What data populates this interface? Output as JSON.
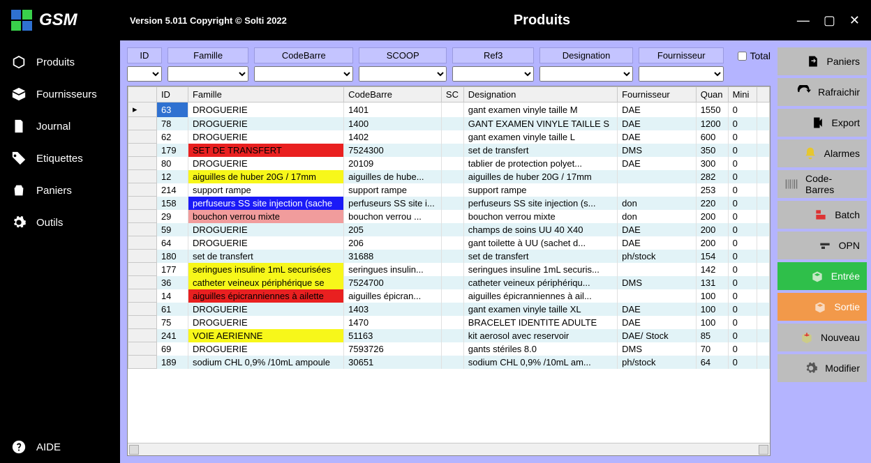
{
  "titlebar": {
    "app_name": "GSM",
    "version": "Version 5.011  Copyright © Solti 2022",
    "page": "Produits"
  },
  "sidebar": {
    "items": [
      {
        "label": "Produits"
      },
      {
        "label": "Fournisseurs"
      },
      {
        "label": "Journal"
      },
      {
        "label": "Etiquettes"
      },
      {
        "label": "Paniers"
      },
      {
        "label": "Outils"
      }
    ],
    "help": "AIDE"
  },
  "filters": {
    "id": "ID",
    "famille": "Famille",
    "codebarre": "CodeBarre",
    "scoop": "SCOOP",
    "ref3": "Ref3",
    "designation": "Designation",
    "fournisseur": "Fournisseur",
    "total": "Total"
  },
  "grid": {
    "headers": {
      "id": "ID",
      "famille": "Famille",
      "codebarre": "CodeBarre",
      "scoop": "SC",
      "designation": "Designation",
      "fournisseur": "Fournisseur",
      "quantite": "Quan",
      "mini": "Mini"
    },
    "rows": [
      {
        "id": "63",
        "id_sel": true,
        "famille": "DROGUERIE",
        "fam_cls": "",
        "cb": "1401",
        "des": "gant examen vinyle taille M",
        "fou": "DAE",
        "q": "1550",
        "m": "0",
        "sel": true
      },
      {
        "id": "78",
        "famille": "DROGUERIE",
        "fam_cls": "",
        "cb": "1400",
        "des": "GANT EXAMEN VINYLE TAILLE S",
        "fou": "DAE",
        "q": "1200",
        "m": "0"
      },
      {
        "id": "62",
        "famille": "DROGUERIE",
        "fam_cls": "",
        "cb": "1402",
        "des": "gant examen vinyle taille L",
        "fou": "DAE",
        "q": "600",
        "m": "0"
      },
      {
        "id": "179",
        "famille": "SET DE TRANSFERT",
        "fam_cls": "fam-red",
        "cb": "7524300",
        "des": "set de transfert",
        "fou": "DMS",
        "q": "350",
        "m": "0"
      },
      {
        "id": "80",
        "famille": "DROGUERIE",
        "fam_cls": "",
        "cb": "20109",
        "des": "tablier de protection polyet...",
        "fou": "DAE",
        "q": "300",
        "m": "0"
      },
      {
        "id": "12",
        "famille": "aiguilles de huber 20G / 17mm",
        "fam_cls": "fam-yellow",
        "cb": "aiguilles de hube...",
        "des": "aiguilles de huber 20G / 17mm",
        "fou": "",
        "q": "282",
        "m": "0"
      },
      {
        "id": "214",
        "famille": "support rampe",
        "fam_cls": "",
        "cb": "support rampe",
        "des": "support rampe",
        "fou": "",
        "q": "253",
        "m": "0"
      },
      {
        "id": "158",
        "famille": "perfuseurs SS site injection (sache",
        "fam_cls": "fam-blue",
        "cb": "perfuseurs SS site i...",
        "des": "perfuseurs SS site injection (s...",
        "fou": "don",
        "q": "220",
        "m": "0"
      },
      {
        "id": "29",
        "famille": "bouchon verrou mixte",
        "fam_cls": "fam-salmon",
        "cb": "bouchon verrou ...",
        "des": "bouchon verrou mixte",
        "fou": "don",
        "q": "200",
        "m": "0"
      },
      {
        "id": "59",
        "famille": "DROGUERIE",
        "fam_cls": "",
        "cb": "205",
        "des": "champs de soins UU  40 X40",
        "fou": "DAE",
        "q": "200",
        "m": "0"
      },
      {
        "id": "64",
        "famille": "DROGUERIE",
        "fam_cls": "",
        "cb": "206",
        "des": "gant toilette à UU (sachet d...",
        "fou": "DAE",
        "q": "200",
        "m": "0"
      },
      {
        "id": "180",
        "famille": "set de transfert",
        "fam_cls": "",
        "cb": "31688",
        "des": "set de transfert",
        "fou": "ph/stock",
        "q": "154",
        "m": "0"
      },
      {
        "id": "177",
        "famille": "seringues insuline 1mL securisées",
        "fam_cls": "fam-yellow",
        "cb": "seringues insulin...",
        "des": "seringues insuline 1mL securis...",
        "fou": "",
        "q": "142",
        "m": "0"
      },
      {
        "id": "36",
        "famille": "catheter veineux périphérique se",
        "fam_cls": "fam-yellow",
        "cb": "7524700",
        "des": "catheter veineux périphériqu...",
        "fou": "DMS",
        "q": "131",
        "m": "0"
      },
      {
        "id": "14",
        "famille": "aiguilles épicranniennes à ailette",
        "fam_cls": "fam-red",
        "cb": "aiguilles épicran...",
        "des": "aiguilles épicranniennes à ail...",
        "fou": "",
        "q": "100",
        "m": "0"
      },
      {
        "id": "61",
        "famille": "DROGUERIE",
        "fam_cls": "",
        "cb": "1403",
        "des": "gant examen vinyle taille XL",
        "fou": "DAE",
        "q": "100",
        "m": "0"
      },
      {
        "id": "75",
        "famille": "DROGUERIE",
        "fam_cls": "",
        "cb": "1470",
        "des": "BRACELET IDENTITE ADULTE",
        "fou": "DAE",
        "q": "100",
        "m": "0"
      },
      {
        "id": "241",
        "famille": "VOIE AERIENNE",
        "fam_cls": "fam-yellow",
        "cb": "51163",
        "des": "kit aerosol avec reservoir",
        "fou": "DAE/ Stock",
        "q": "85",
        "m": "0"
      },
      {
        "id": "69",
        "famille": "DROGUERIE",
        "fam_cls": "",
        "cb": "7593726",
        "des": "gants stériles 8.0",
        "fou": "DMS",
        "q": "70",
        "m": "0"
      },
      {
        "id": "189",
        "famille": "sodium CHL 0,9% /10mL ampoule",
        "fam_cls": "",
        "cb": "30651",
        "des": "sodium CHL 0,9% /10mL am...",
        "fou": "ph/stock",
        "q": "64",
        "m": "0"
      }
    ]
  },
  "actions": {
    "paniers": "Paniers",
    "rafraichir": "Rafraichir",
    "export": "Export",
    "alarmes": "Alarmes",
    "codebarres": "Code-Barres",
    "batch": "Batch",
    "opn": "OPN",
    "entree": "Entrée",
    "sortie": "Sortie",
    "nouveau": "Nouveau",
    "modifier": "Modifier"
  }
}
